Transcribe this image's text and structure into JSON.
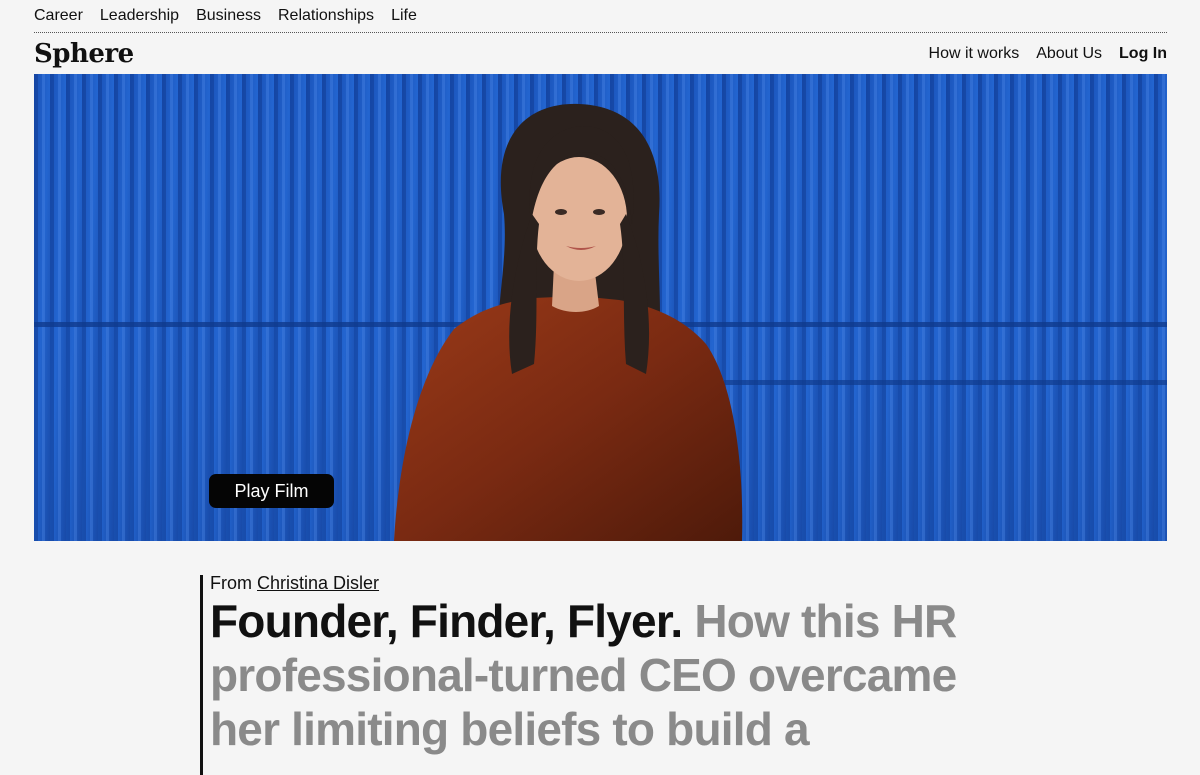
{
  "top_nav": {
    "items": [
      {
        "label": "Career"
      },
      {
        "label": "Leadership"
      },
      {
        "label": "Business"
      },
      {
        "label": "Relationships"
      },
      {
        "label": "Life"
      }
    ]
  },
  "header": {
    "logo": "Sphere",
    "nav": {
      "how_it_works": "How it works",
      "about_us": "About Us",
      "log_in": "Log In"
    }
  },
  "hero": {
    "play_label": "Play Film",
    "colors": {
      "wall": "#1f5cc4",
      "sweater": "#7a2a12",
      "hair": "#2b211d"
    }
  },
  "article": {
    "from_label": "From",
    "author": "Christina Disler",
    "headline_lead": "Founder, Finder, Flyer.",
    "headline_rest": "How this HR professional-turned CEO overcame her limiting beliefs to build a"
  }
}
